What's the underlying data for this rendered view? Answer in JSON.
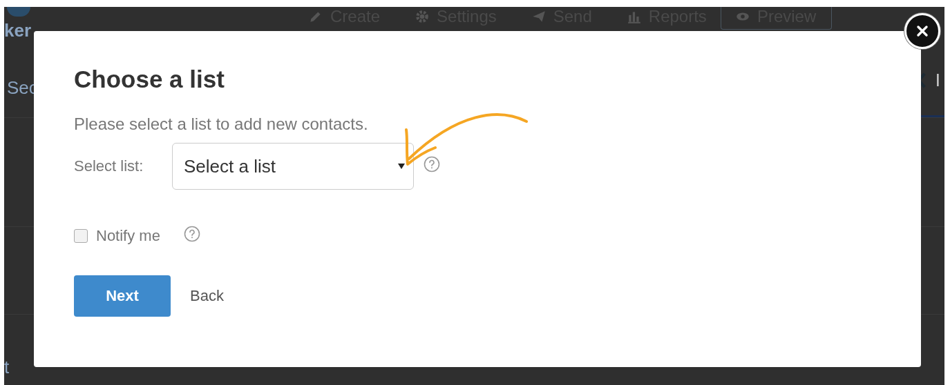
{
  "background_page": {
    "logo_text": "ker",
    "nav": [
      {
        "label": "Create",
        "kind": "link"
      },
      {
        "label": "Settings",
        "kind": "link"
      },
      {
        "label": "Send",
        "kind": "link"
      },
      {
        "label": "Reports",
        "kind": "link"
      },
      {
        "label": "Preview",
        "kind": "button"
      }
    ],
    "section_text": "Sec",
    "side_text": "I",
    "bottom_text": "t"
  },
  "dialog": {
    "title": "Choose a list",
    "description": "Please select a list to add new contacts.",
    "select_list": {
      "label": "Select list:",
      "placeholder": "Select a list"
    },
    "notify": {
      "label": "Notify me",
      "checked": false
    },
    "buttons": [
      {
        "label": "Next",
        "kind": "primary"
      },
      {
        "label": "Back",
        "kind": "link"
      }
    ]
  }
}
